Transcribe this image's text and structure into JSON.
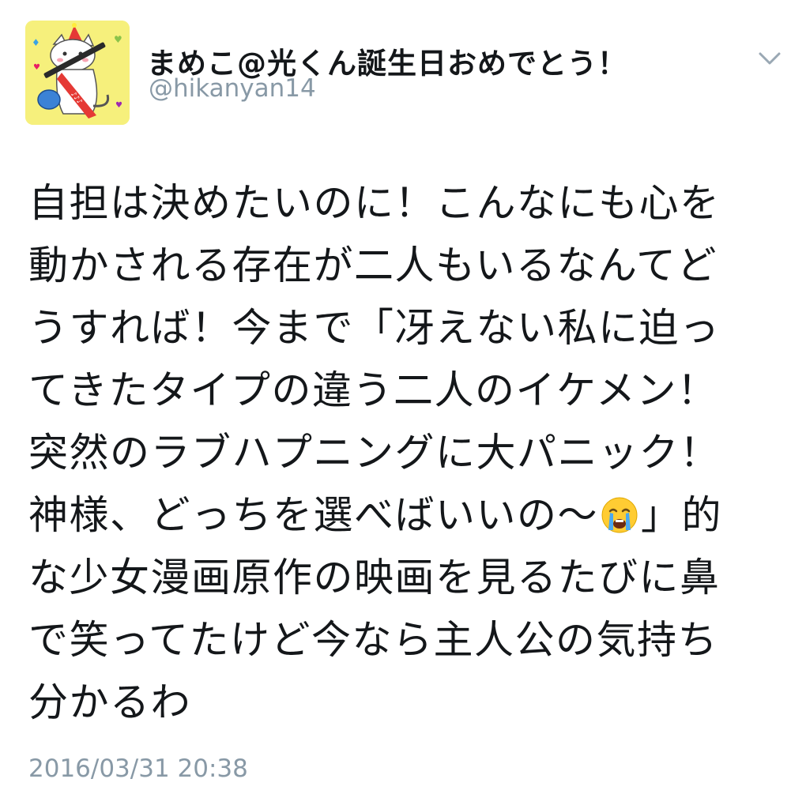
{
  "author": {
    "display_name": "まめこ@光くん誕生日おめでとう！",
    "handle": "@hikanyan14",
    "avatar_icon": "cat-with-guitar-avatar"
  },
  "menu": {
    "icon": "chevron-down-icon"
  },
  "tweet": {
    "lines": [
      "自担は決めたいのに！こんなにも心を",
      "動かされる存在が二人もいるなんてど",
      "うすれば！今まで「冴えない私に迫っ",
      "てきたタイプの違う二人のイケメン！",
      "突然のラブハプニングに大パニック！",
      "神様、どっちを選べばいいの〜",
      "」的",
      "な少女漫画原作の映画を見るたびに鼻",
      "で笑ってたけど今なら主人公の気持ち",
      "分かるわ"
    ],
    "emoji": "loudly-crying-face-emoji",
    "timestamp": "2016/03/31 20:38"
  },
  "colors": {
    "text": "#14171a",
    "secondary": "#8899a6",
    "avatar_bg": "#f6f07c"
  }
}
